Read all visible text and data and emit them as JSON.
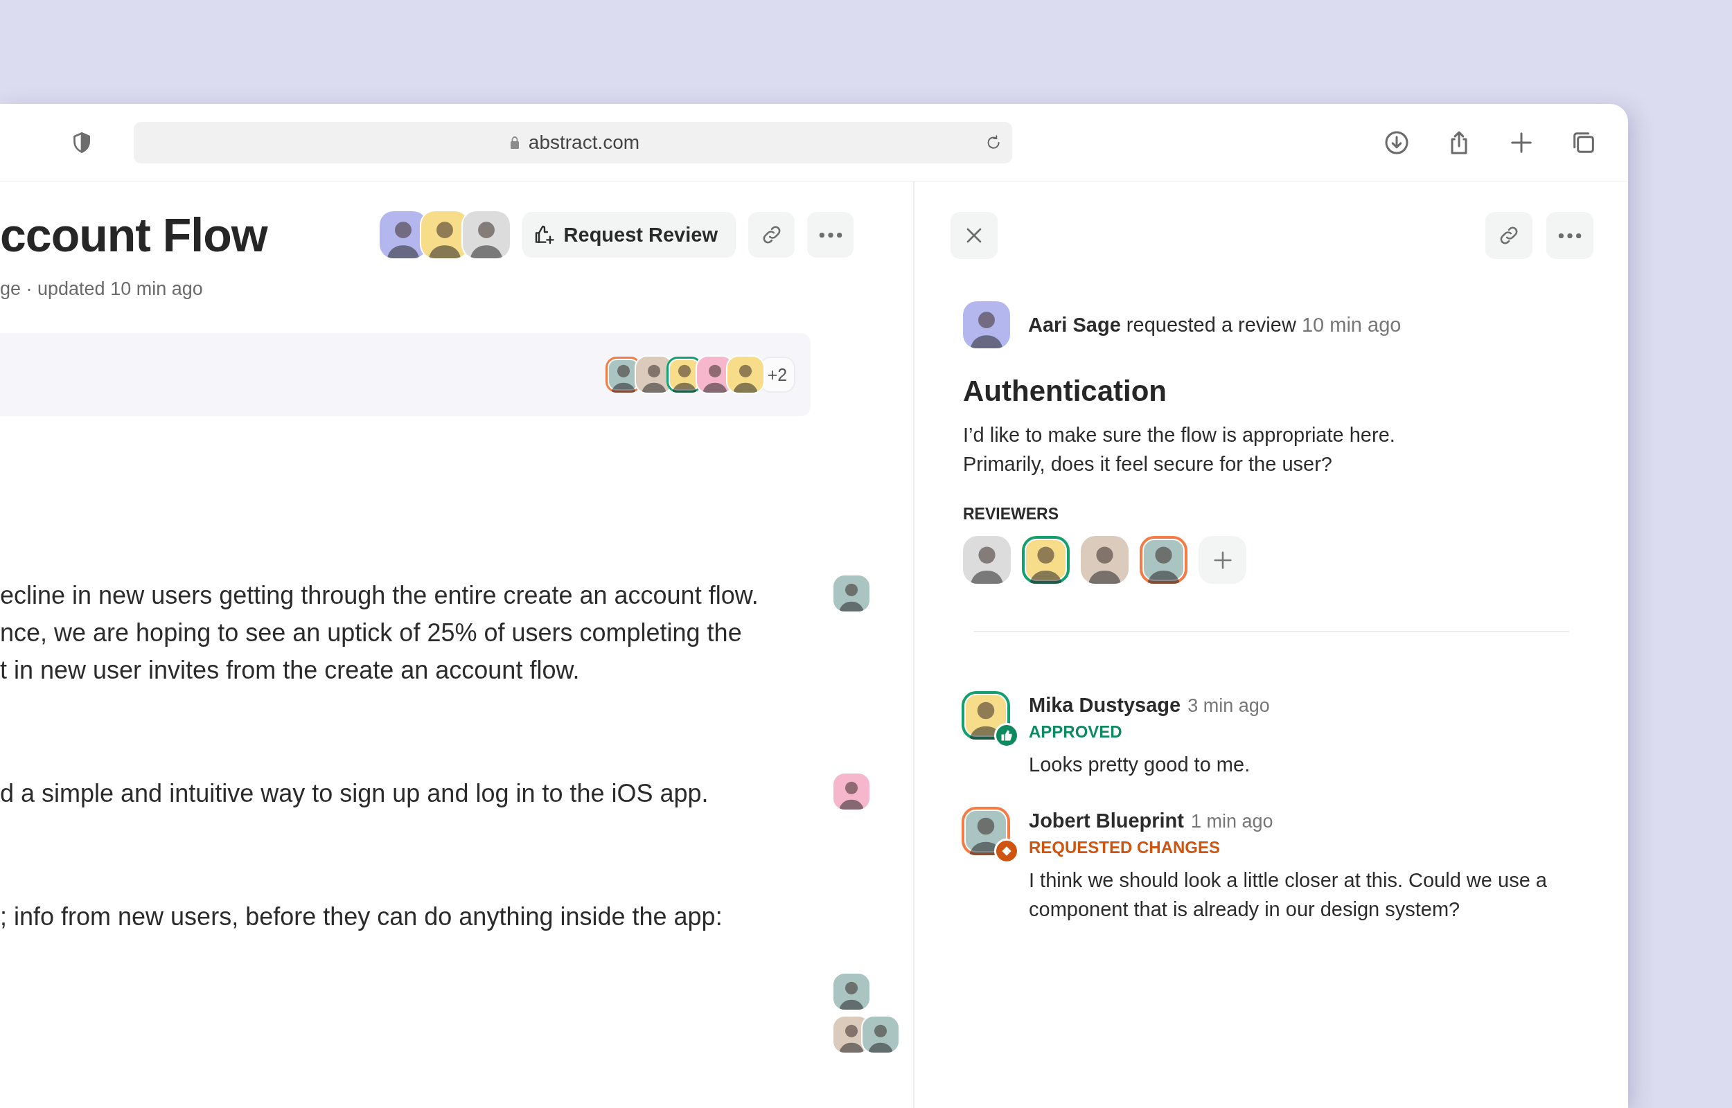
{
  "browser": {
    "url": "abstract.com"
  },
  "document": {
    "title": "ccount Flow",
    "meta": "ge · updated 10 min ago",
    "collaborators": [
      {
        "color": "#b4b6ee"
      },
      {
        "color": "#f7dc8a"
      },
      {
        "color": "#dcdcdc"
      }
    ],
    "request_review_label": "Request Review",
    "viewers": [
      {
        "color": "#a9c4c1",
        "approved": false,
        "changes_requested": true
      },
      {
        "color": "#dacbbd",
        "approved": false,
        "changes_requested": false
      },
      {
        "color": "#f7dc8a",
        "approved": true,
        "changes_requested": false
      },
      {
        "color": "#f6b7cd",
        "approved": false,
        "changes_requested": false
      },
      {
        "color": "#f7dc8a",
        "approved": false,
        "changes_requested": false
      }
    ],
    "viewers_more": "+2",
    "paragraphs": [
      {
        "text": "ecline in new users getting through the entire create an account flow.\nnce, we are hoping to see an uptick of 25% of users completing the\nt in new user invites from the create an account flow.",
        "commenters": [
          {
            "color": "#a9c4c1"
          }
        ]
      },
      {
        "text": "d a simple and intuitive way to sign up and log in to the iOS app.",
        "commenters": [
          {
            "color": "#f6b7cd"
          }
        ]
      },
      {
        "text": "; info from new users, before they can do anything inside the app:"
      }
    ],
    "thread_markers": [
      [
        {
          "color": "#a9c4c1"
        }
      ],
      [
        {
          "color": "#dacbbd"
        },
        {
          "color": "#a9c4c1"
        }
      ]
    ]
  },
  "review": {
    "requester": {
      "name": "Aari Sage",
      "action": "requested a review",
      "time": "10 min ago",
      "color": "#b4b6ee"
    },
    "title": "Authentication",
    "description": "I’d like to make sure the flow is appropriate here.\nPrimarily, does it feel secure for the user?",
    "reviewers_label": "REVIEWERS",
    "reviewers": [
      {
        "color": "#dcdcdc",
        "approved": false,
        "changes_requested": false
      },
      {
        "color": "#f7dc8a",
        "approved": true,
        "changes_requested": false
      },
      {
        "color": "#dacbbd",
        "approved": false,
        "changes_requested": false
      },
      {
        "color": "#a9c4c1",
        "approved": false,
        "changes_requested": true
      }
    ],
    "comments": [
      {
        "name": "Mika Dustysage",
        "time": "3 min ago",
        "kind": "approval",
        "status_label": "APPROVED",
        "body": "Looks pretty good to me.",
        "color": "#f7dc8a"
      },
      {
        "name": "Jobert Blueprint",
        "time": "1 min ago",
        "kind": "changes",
        "status_label": "REQUESTED CHANGES",
        "body": "I think we should look a little closer at this. Could we use a\ncomponent that is already in our design system?",
        "color": "#a9c4c1"
      }
    ]
  }
}
